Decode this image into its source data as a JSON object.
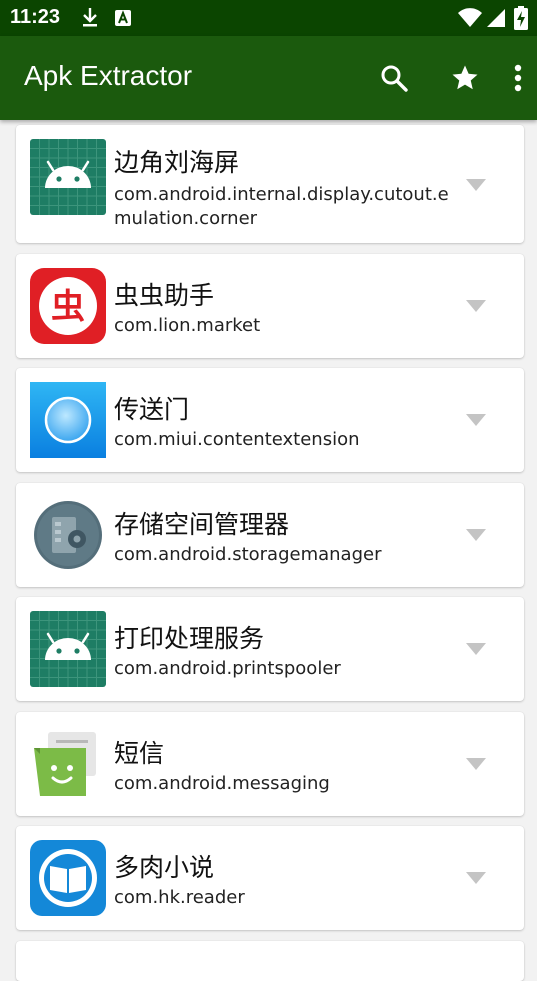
{
  "status_bar": {
    "time": "11:23"
  },
  "app_bar": {
    "title": "Apk Extractor"
  },
  "apps": [
    {
      "name": "边角刘海屏",
      "package": "com.android.internal.display.cutout.emulation.corner",
      "icon": "android-robot-icon"
    },
    {
      "name": "虫虫助手",
      "package": "com.lion.market",
      "icon": "chongchong-icon"
    },
    {
      "name": "传送门",
      "package": "com.miui.contentextension",
      "icon": "portal-icon"
    },
    {
      "name": "存储空间管理器",
      "package": "com.android.storagemanager",
      "icon": "storage-manager-icon"
    },
    {
      "name": "打印处理服务",
      "package": "com.android.printspooler",
      "icon": "android-robot-icon"
    },
    {
      "name": "短信",
      "package": "com.android.messaging",
      "icon": "messaging-icon"
    },
    {
      "name": "多肉小说",
      "package": "com.hk.reader",
      "icon": "reader-book-icon"
    }
  ],
  "colors": {
    "status_bar": "#0b4500",
    "app_bar": "#1b5a0d",
    "background": "#f2f2f2",
    "card": "#ffffff"
  }
}
